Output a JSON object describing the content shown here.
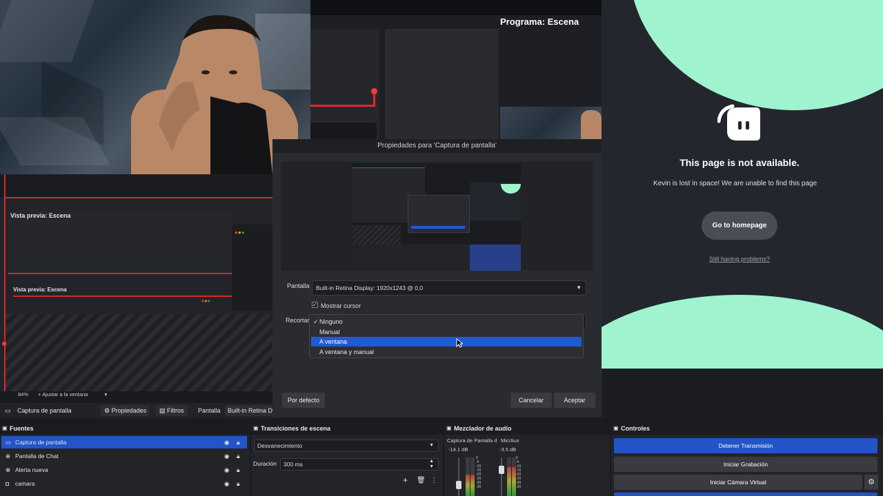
{
  "program": {
    "title": "Programa: Escena"
  },
  "preview": {
    "title_a": "Vista previa: Escena",
    "title_b": "Vista previa: Escena",
    "zoom": "84%",
    "fit_label": "Ajustar a la ventana"
  },
  "dialog": {
    "title": "Propiedades para 'Captura de pantalla'",
    "pantalla_label": "Pantalla",
    "pantalla_value": "Built-in Retina Display: 1920x1243 @ 0,0",
    "mostrar_cursor_label": "Mostrar cursor",
    "mostrar_cursor_checked": true,
    "recortar_label": "Recortar",
    "recortar_options": [
      {
        "label": "Ninguno",
        "checked": true,
        "selected": false
      },
      {
        "label": "Manual",
        "checked": false,
        "selected": false
      },
      {
        "label": "A ventana",
        "checked": false,
        "selected": true
      },
      {
        "label": "A ventana y manual",
        "checked": false,
        "selected": false
      }
    ],
    "default_button": "Por defecto",
    "cancel_button": "Cancelar",
    "accept_button": "Aceptar"
  },
  "browser": {
    "headline": "This page is not available.",
    "message": "Kevin is lost in space! We are unable to find this page",
    "home_button": "Go to homepage",
    "help_link": "Still having problems?",
    "accent_color": "#9ff3cf"
  },
  "toolbar": {
    "source_name": "Captura de pantalla",
    "properties": "Propiedades",
    "filters": "Filtros",
    "pantalla": "Pantalla",
    "display": "Built-in Retina Di"
  },
  "sources": {
    "title": "Fuentes",
    "items": [
      {
        "label": "Captura de pantalla",
        "icon": "monitor-icon",
        "selected": true
      },
      {
        "label": "Pantalla de Chat",
        "icon": "globe-icon",
        "selected": false
      },
      {
        "label": "Alerta nueva",
        "icon": "globe-icon",
        "selected": false
      },
      {
        "label": "camara",
        "icon": "camera-icon",
        "selected": false
      }
    ]
  },
  "transitions": {
    "title": "Transiciones de escena",
    "type": "Desvanecimiento",
    "duration_label": "Duración",
    "duration_value": "300 ms"
  },
  "mixer": {
    "title": "Mezclador de audio",
    "channels": [
      {
        "name": "Captura de Pantalla d",
        "db": "-14.1 dB",
        "level": 0.55
      },
      {
        "name": "Mic/Aux",
        "db": "-3.5 dB",
        "level": 0.75
      }
    ],
    "meter_ticks": [
      "0",
      "-5",
      "-10",
      "-15",
      "-20",
      "-25",
      "-30",
      "-35"
    ]
  },
  "controls": {
    "title": "Controles",
    "stop_stream": "Detener Transmisión",
    "start_recording": "Iniciar Grabación",
    "start_virtual_cam": "Iniciar Cámara Virtual"
  }
}
